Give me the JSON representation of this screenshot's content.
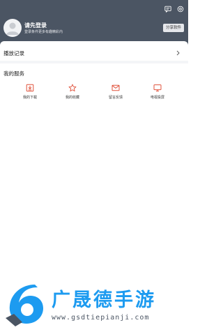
{
  "header": {
    "message_icon": "message-icon",
    "settings_icon": "settings-icon",
    "user": {
      "name": "请先登录",
      "subtitle": "登录条件更多有趣精彩内"
    },
    "share_label": "分享软件"
  },
  "history": {
    "label": "播放记录",
    "chevron_icon": "chevron-right-icon"
  },
  "services": {
    "title": "我的服务",
    "items": [
      {
        "label": "我的下载",
        "icon": "download-icon"
      },
      {
        "label": "我的收藏",
        "icon": "star-icon"
      },
      {
        "label": "留言反馈",
        "icon": "mail-icon"
      },
      {
        "label": "电视投屏",
        "icon": "tv-cast-icon"
      }
    ]
  },
  "watermark": {
    "brand": "广晟德手游",
    "url": "www.gsdtiepianji.com"
  },
  "colors": {
    "header_bg": "#4b5563",
    "accent": "#e0533d",
    "watermark_blue": "#1d9bf0"
  }
}
